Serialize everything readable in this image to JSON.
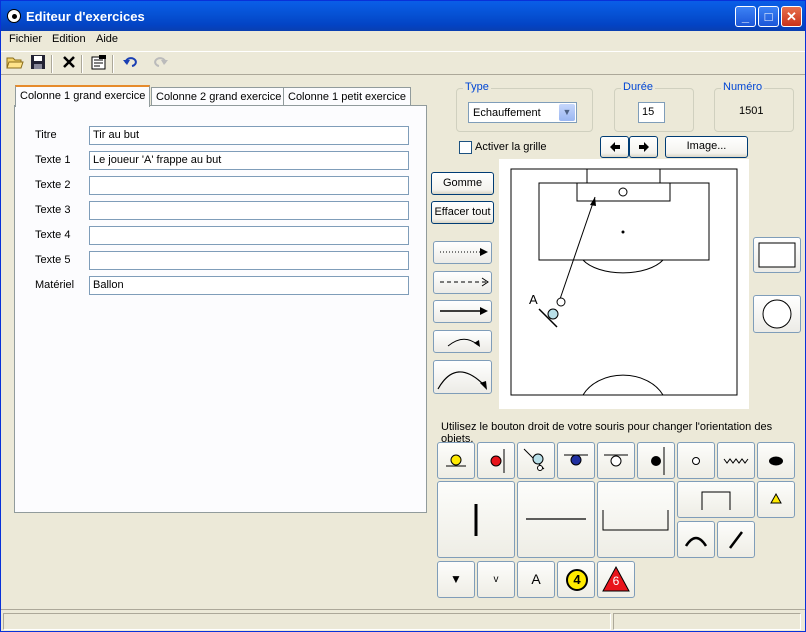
{
  "window": {
    "title": "Editeur d'exercices",
    "minimize": "_",
    "maximize": "□",
    "close": "✕"
  },
  "menu": [
    "Fichier",
    "Edition",
    "Aide"
  ],
  "toolbar": {
    "icons": [
      "open-folder-icon",
      "save-icon",
      "delete-icon",
      "properties-icon",
      "undo-icon",
      "redo-icon"
    ]
  },
  "tabs": [
    "Colonne 1 grand exercice",
    "Colonne 2 grand exercice",
    "Colonne 1 petit exercice"
  ],
  "form": {
    "fields": [
      {
        "label": "Titre",
        "value": "Tir au but"
      },
      {
        "label": "Texte 1",
        "value": "Le joueur 'A' frappe au but"
      },
      {
        "label": "Texte 2",
        "value": ""
      },
      {
        "label": "Texte 3",
        "value": ""
      },
      {
        "label": "Texte 4",
        "value": ""
      },
      {
        "label": "Texte 5",
        "value": ""
      },
      {
        "label": "Matériel",
        "value": "Ballon"
      }
    ]
  },
  "type": {
    "label": "Type",
    "value": "Echauffement"
  },
  "duree": {
    "label": "Durée",
    "value": "15"
  },
  "numero": {
    "label": "Numéro",
    "value": "1501"
  },
  "grid": {
    "label": "Activer la grille",
    "checked": false
  },
  "image_button": "Image...",
  "gomme": "Gomme",
  "effacer": "Effacer tout",
  "player_label": "A",
  "hint": "Utilisez le bouton droit de votre souris pour changer l'orientation des objets.",
  "tool_text": {
    "letter_a": "A",
    "number_4": "4",
    "number_6": "6",
    "small_v": "v"
  },
  "colors": {
    "accent_tab": "#e68b2c",
    "title_blue": "#0653d6",
    "group_label": "#0046d5",
    "yellow": "#ffea00",
    "red": "#e8141b",
    "blue_ball": "#2030a0"
  }
}
